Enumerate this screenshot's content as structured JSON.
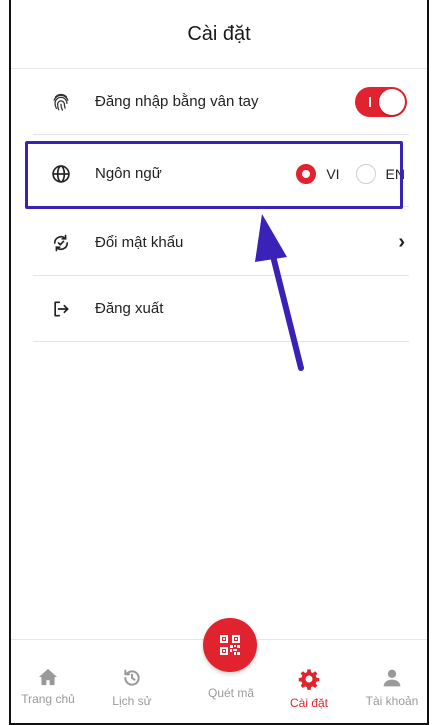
{
  "header": {
    "title": "Cài đặt"
  },
  "settings": {
    "fingerprint": {
      "label": "Đăng nhập bằng vân tay",
      "enabled": true
    },
    "language": {
      "label": "Ngôn ngữ",
      "options": [
        "VI",
        "EN"
      ],
      "selected": "VI"
    },
    "change_password": {
      "label": "Đổi mật khẩu",
      "chevron": "›"
    },
    "logout": {
      "label": "Đăng xuất"
    }
  },
  "tabbar": {
    "items": [
      {
        "label": "Trang chủ",
        "icon": "home-icon"
      },
      {
        "label": "Lịch sử",
        "icon": "history-icon"
      },
      {
        "label": "Quét mã",
        "icon": "qr-code-icon"
      },
      {
        "label": "Cài đặt",
        "icon": "gear-icon",
        "active": true
      },
      {
        "label": "Tài khoản",
        "icon": "user-icon"
      }
    ]
  },
  "colors": {
    "accent": "#e0232e",
    "annotation": "#3a22b8",
    "inactive": "#9a9a9a"
  }
}
